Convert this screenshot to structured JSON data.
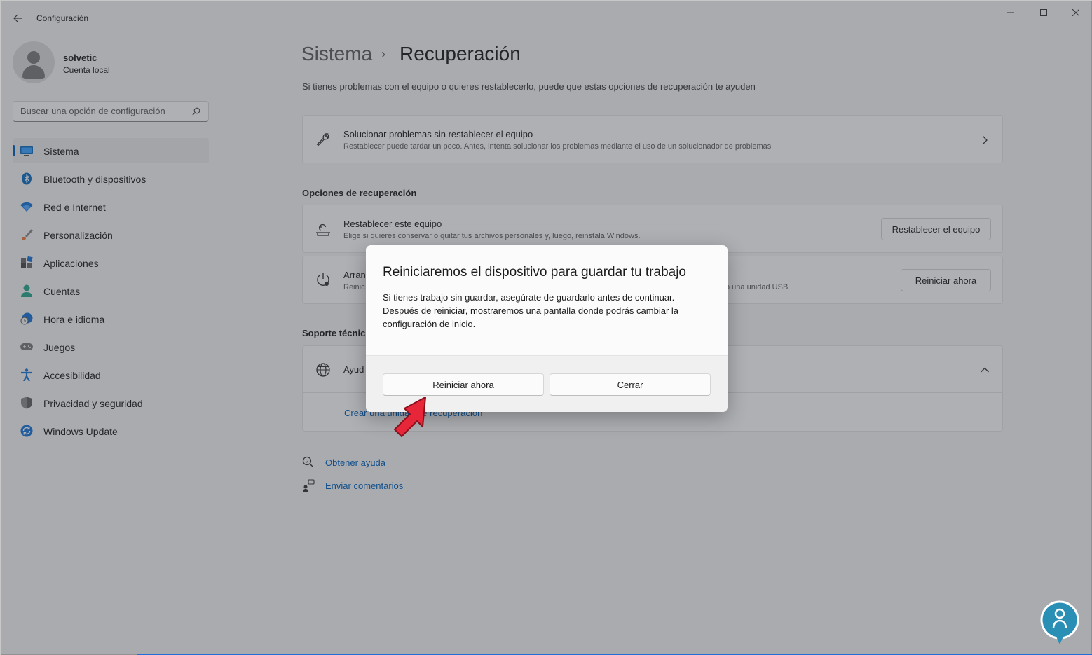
{
  "window": {
    "title": "Configuración",
    "controls": {
      "minimize": "minimize-icon",
      "maximize": "maximize-icon",
      "close": "close-icon"
    }
  },
  "profile": {
    "name": "solvetic",
    "account_type": "Cuenta local"
  },
  "search": {
    "placeholder": "Buscar una opción de configuración"
  },
  "sidebar": {
    "items": [
      {
        "label": "Sistema",
        "icon": "system-icon",
        "active": true
      },
      {
        "label": "Bluetooth y dispositivos",
        "icon": "bluetooth-icon"
      },
      {
        "label": "Red e Internet",
        "icon": "wifi-icon"
      },
      {
        "label": "Personalización",
        "icon": "brush-icon"
      },
      {
        "label": "Aplicaciones",
        "icon": "apps-icon"
      },
      {
        "label": "Cuentas",
        "icon": "person-icon"
      },
      {
        "label": "Hora e idioma",
        "icon": "clock-globe-icon"
      },
      {
        "label": "Juegos",
        "icon": "gamepad-icon"
      },
      {
        "label": "Accesibilidad",
        "icon": "accessibility-icon"
      },
      {
        "label": "Privacidad y seguridad",
        "icon": "shield-icon"
      },
      {
        "label": "Windows Update",
        "icon": "update-icon"
      }
    ]
  },
  "header": {
    "parent": "Sistema",
    "separator": "›",
    "current": "Recuperación"
  },
  "main": {
    "subtitle": "Si tienes problemas con el equipo o quieres restablecerlo, puede que estas opciones de recuperación te ayuden",
    "troubleshoot": {
      "title": "Solucionar problemas sin restablecer el equipo",
      "description": "Restablecer puede tardar un poco. Antes, intenta solucionar los problemas mediante el uso de un solucionador de problemas"
    },
    "recovery_section": "Opciones de recuperación",
    "reset": {
      "title": "Restablecer este equipo",
      "description": "Elige si quieres conservar o quitar tus archivos personales y, luego, reinstala Windows.",
      "button": "Restablecer el equipo"
    },
    "advanced_startup": {
      "title": "Arran",
      "description": "Reinic",
      "description_tail": "o una unidad USB",
      "button": "Reiniciar ahora"
    },
    "support_section": "Soporte técnic",
    "help": {
      "title": "Ayud"
    },
    "recovery_drive_link": "Crear una unidad de recuperación",
    "footer_links": [
      {
        "label": "Obtener ayuda",
        "icon": "help-icon"
      },
      {
        "label": "Enviar comentarios",
        "icon": "feedback-icon"
      }
    ]
  },
  "dialog": {
    "title": "Reiniciaremos el dispositivo para guardar tu trabajo",
    "body": "Si tienes trabajo sin guardar, asegúrate de guardarlo antes de continuar. Después de reiniciar, mostraremos una pantalla donde podrás cambiar la configuración de inicio.",
    "primary_button": "Reiniciar ahora",
    "secondary_button": "Cerrar"
  },
  "colors": {
    "accent": "#005fb8",
    "annotation_arrow": "#e8263a"
  }
}
